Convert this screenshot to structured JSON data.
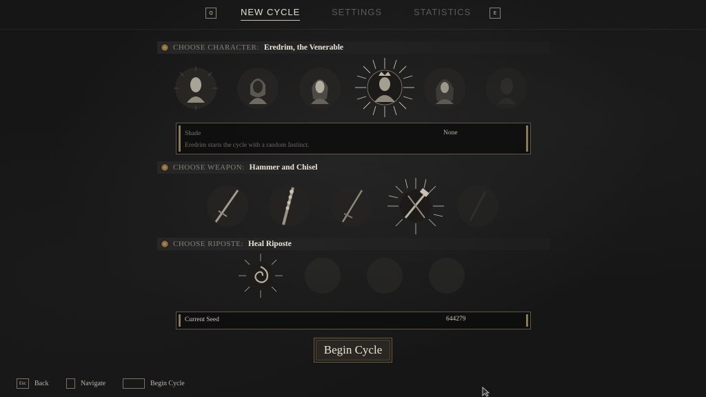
{
  "nav": {
    "left_key": "Q",
    "right_key": "E",
    "tabs": [
      {
        "label": "NEW CYCLE",
        "active": true
      },
      {
        "label": "SETTINGS",
        "active": false
      },
      {
        "label": "STATISTICS",
        "active": false
      }
    ]
  },
  "character": {
    "label": "CHOOSE CHARACTER:",
    "selected": "Eredrim, the Venerable",
    "portraits": [
      {
        "icon": "character-portrait-icon",
        "state": "available"
      },
      {
        "icon": "character-portrait-icon",
        "state": "available"
      },
      {
        "icon": "character-portrait-icon",
        "state": "available"
      },
      {
        "icon": "character-portrait-icon",
        "state": "selected"
      },
      {
        "icon": "character-portrait-icon",
        "state": "available"
      },
      {
        "icon": "character-portrait-icon",
        "state": "locked"
      }
    ],
    "panel": {
      "trait_label": "Shade",
      "trait_value": "None",
      "description": "Eredrim starts the cycle with a random Instinct."
    }
  },
  "weapon": {
    "label": "CHOOSE WEAPON:",
    "selected": "Hammer and Chisel",
    "items": [
      {
        "icon": "sword-icon",
        "state": "available"
      },
      {
        "icon": "spiked-mace-icon",
        "state": "available"
      },
      {
        "icon": "sword-icon",
        "state": "available"
      },
      {
        "icon": "hammer-and-chisel-icon",
        "state": "selected"
      },
      {
        "icon": "weapon-icon",
        "state": "locked"
      }
    ]
  },
  "riposte": {
    "label": "CHOOSE RIPOSTE:",
    "selected": "Heal Riposte",
    "items": [
      {
        "icon": "heal-riposte-icon",
        "state": "selected"
      },
      {
        "icon": "riposte-icon",
        "state": "locked"
      },
      {
        "icon": "riposte-icon",
        "state": "locked"
      },
      {
        "icon": "riposte-icon",
        "state": "locked"
      }
    ]
  },
  "seed": {
    "label": "Current Seed",
    "value": "644279"
  },
  "begin_button": "Begin Cycle",
  "footer": {
    "back_key": "Esc",
    "back_label": "Back",
    "navigate_label": "Navigate",
    "begin_label": "Begin Cycle"
  },
  "colors": {
    "accent": "#b9935b",
    "text": "#ece6d8",
    "muted": "#86827a"
  }
}
